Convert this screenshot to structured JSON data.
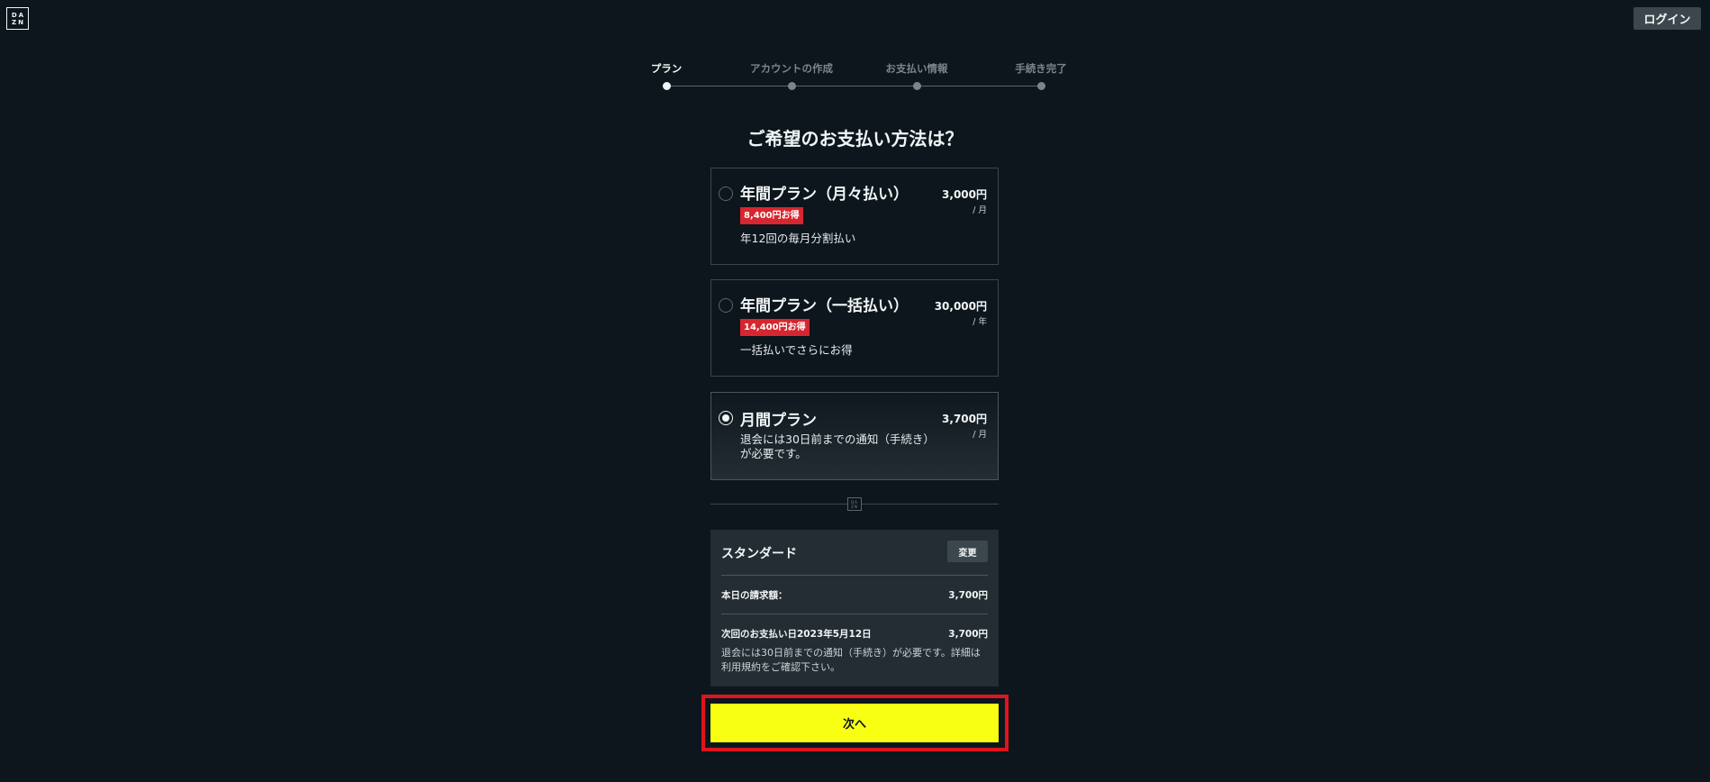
{
  "header": {
    "logo_line1": "DA",
    "logo_line2": "ZN",
    "login_label": "ログイン"
  },
  "stepper": {
    "steps": [
      {
        "label": "プラン",
        "active": true
      },
      {
        "label": "アカウントの作成",
        "active": false
      },
      {
        "label": "お支払い情報",
        "active": false
      },
      {
        "label": "手続き完了",
        "active": false
      }
    ]
  },
  "title": "ご希望のお支払い方法は？",
  "plans": [
    {
      "name": "年間プラン（月々払い）",
      "badge": "8,400円お得",
      "desc": "年12回の毎月分割払い",
      "price": "3,000円",
      "per": "/ 月",
      "selected": false
    },
    {
      "name": "年間プラン（一括払い）",
      "badge": "14,400円お得",
      "desc": "一括払いでさらにお得",
      "price": "30,000円",
      "per": "/ 年",
      "selected": false
    },
    {
      "name": "月間プラン",
      "desc_line1": "退会には30日前までの通知（手続き）",
      "desc_line2": "が必要です。",
      "price": "3,700円",
      "per": "/ 月",
      "selected": true
    }
  ],
  "divider_mark": {
    "line1": "DA",
    "line2": "ZN"
  },
  "summary": {
    "tier": "スタンダード",
    "change_label": "変更",
    "today_label": "本日の請求額：",
    "today_value": "3,700円",
    "next_label": "次回のお支払い日2023年5月12日",
    "next_value": "3,700円",
    "note_line1": "退会には30日前までの通知（手続き）が必要です。詳細は",
    "note_line2": "利用規約をご確認下さい。"
  },
  "next_label": "次へ",
  "colors": {
    "background": "#0c161c",
    "accent_button": "#f8ff13",
    "badge": "#d7262f",
    "highlight_border": "#e0141e"
  }
}
